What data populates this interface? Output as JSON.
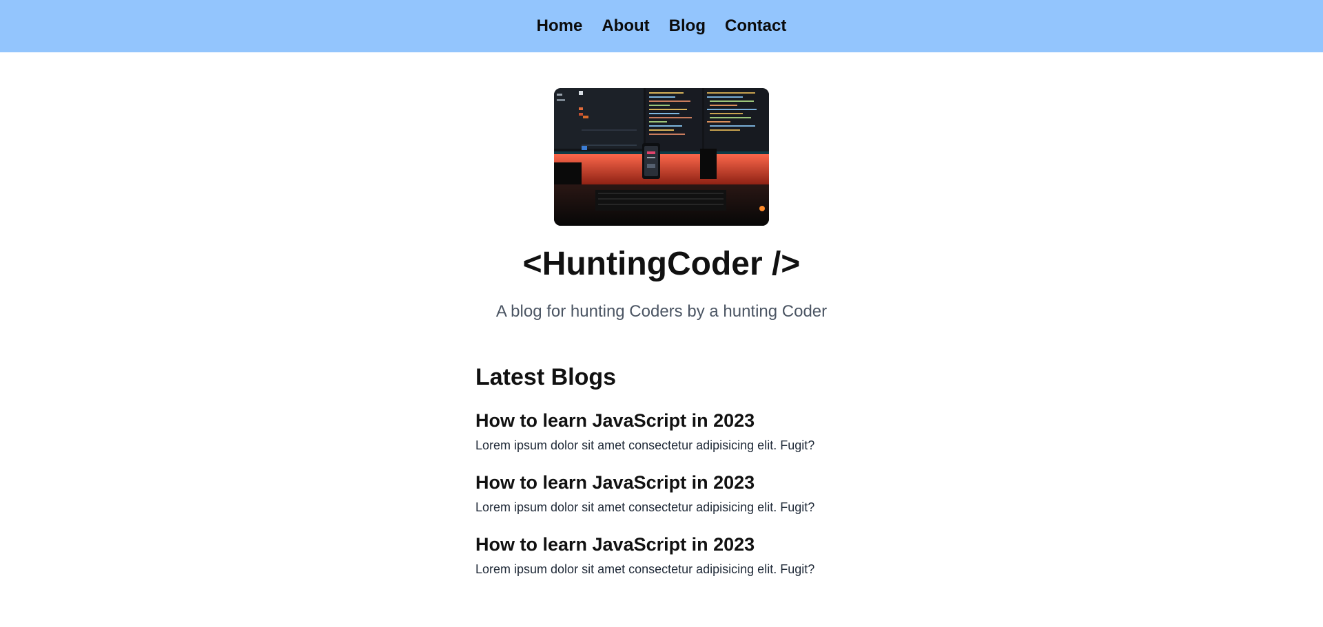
{
  "nav": {
    "items": [
      {
        "label": "Home"
      },
      {
        "label": "About"
      },
      {
        "label": "Blog"
      },
      {
        "label": "Contact"
      }
    ]
  },
  "hero": {
    "title": "<HuntingCoder />",
    "tagline": "A blog for hunting Coders by a hunting Coder"
  },
  "blogs": {
    "heading": "Latest Blogs",
    "items": [
      {
        "title": "How to learn JavaScript in 2023",
        "excerpt": "Lorem ipsum dolor sit amet consectetur adipisicing elit. Fugit?"
      },
      {
        "title": "How to learn JavaScript in 2023",
        "excerpt": "Lorem ipsum dolor sit amet consectetur adipisicing elit. Fugit?"
      },
      {
        "title": "How to learn JavaScript in 2023",
        "excerpt": "Lorem ipsum dolor sit amet consectetur adipisicing elit. Fugit?"
      }
    ]
  },
  "colors": {
    "navbar": "#93c5fd",
    "tagline": "#4b5563"
  }
}
